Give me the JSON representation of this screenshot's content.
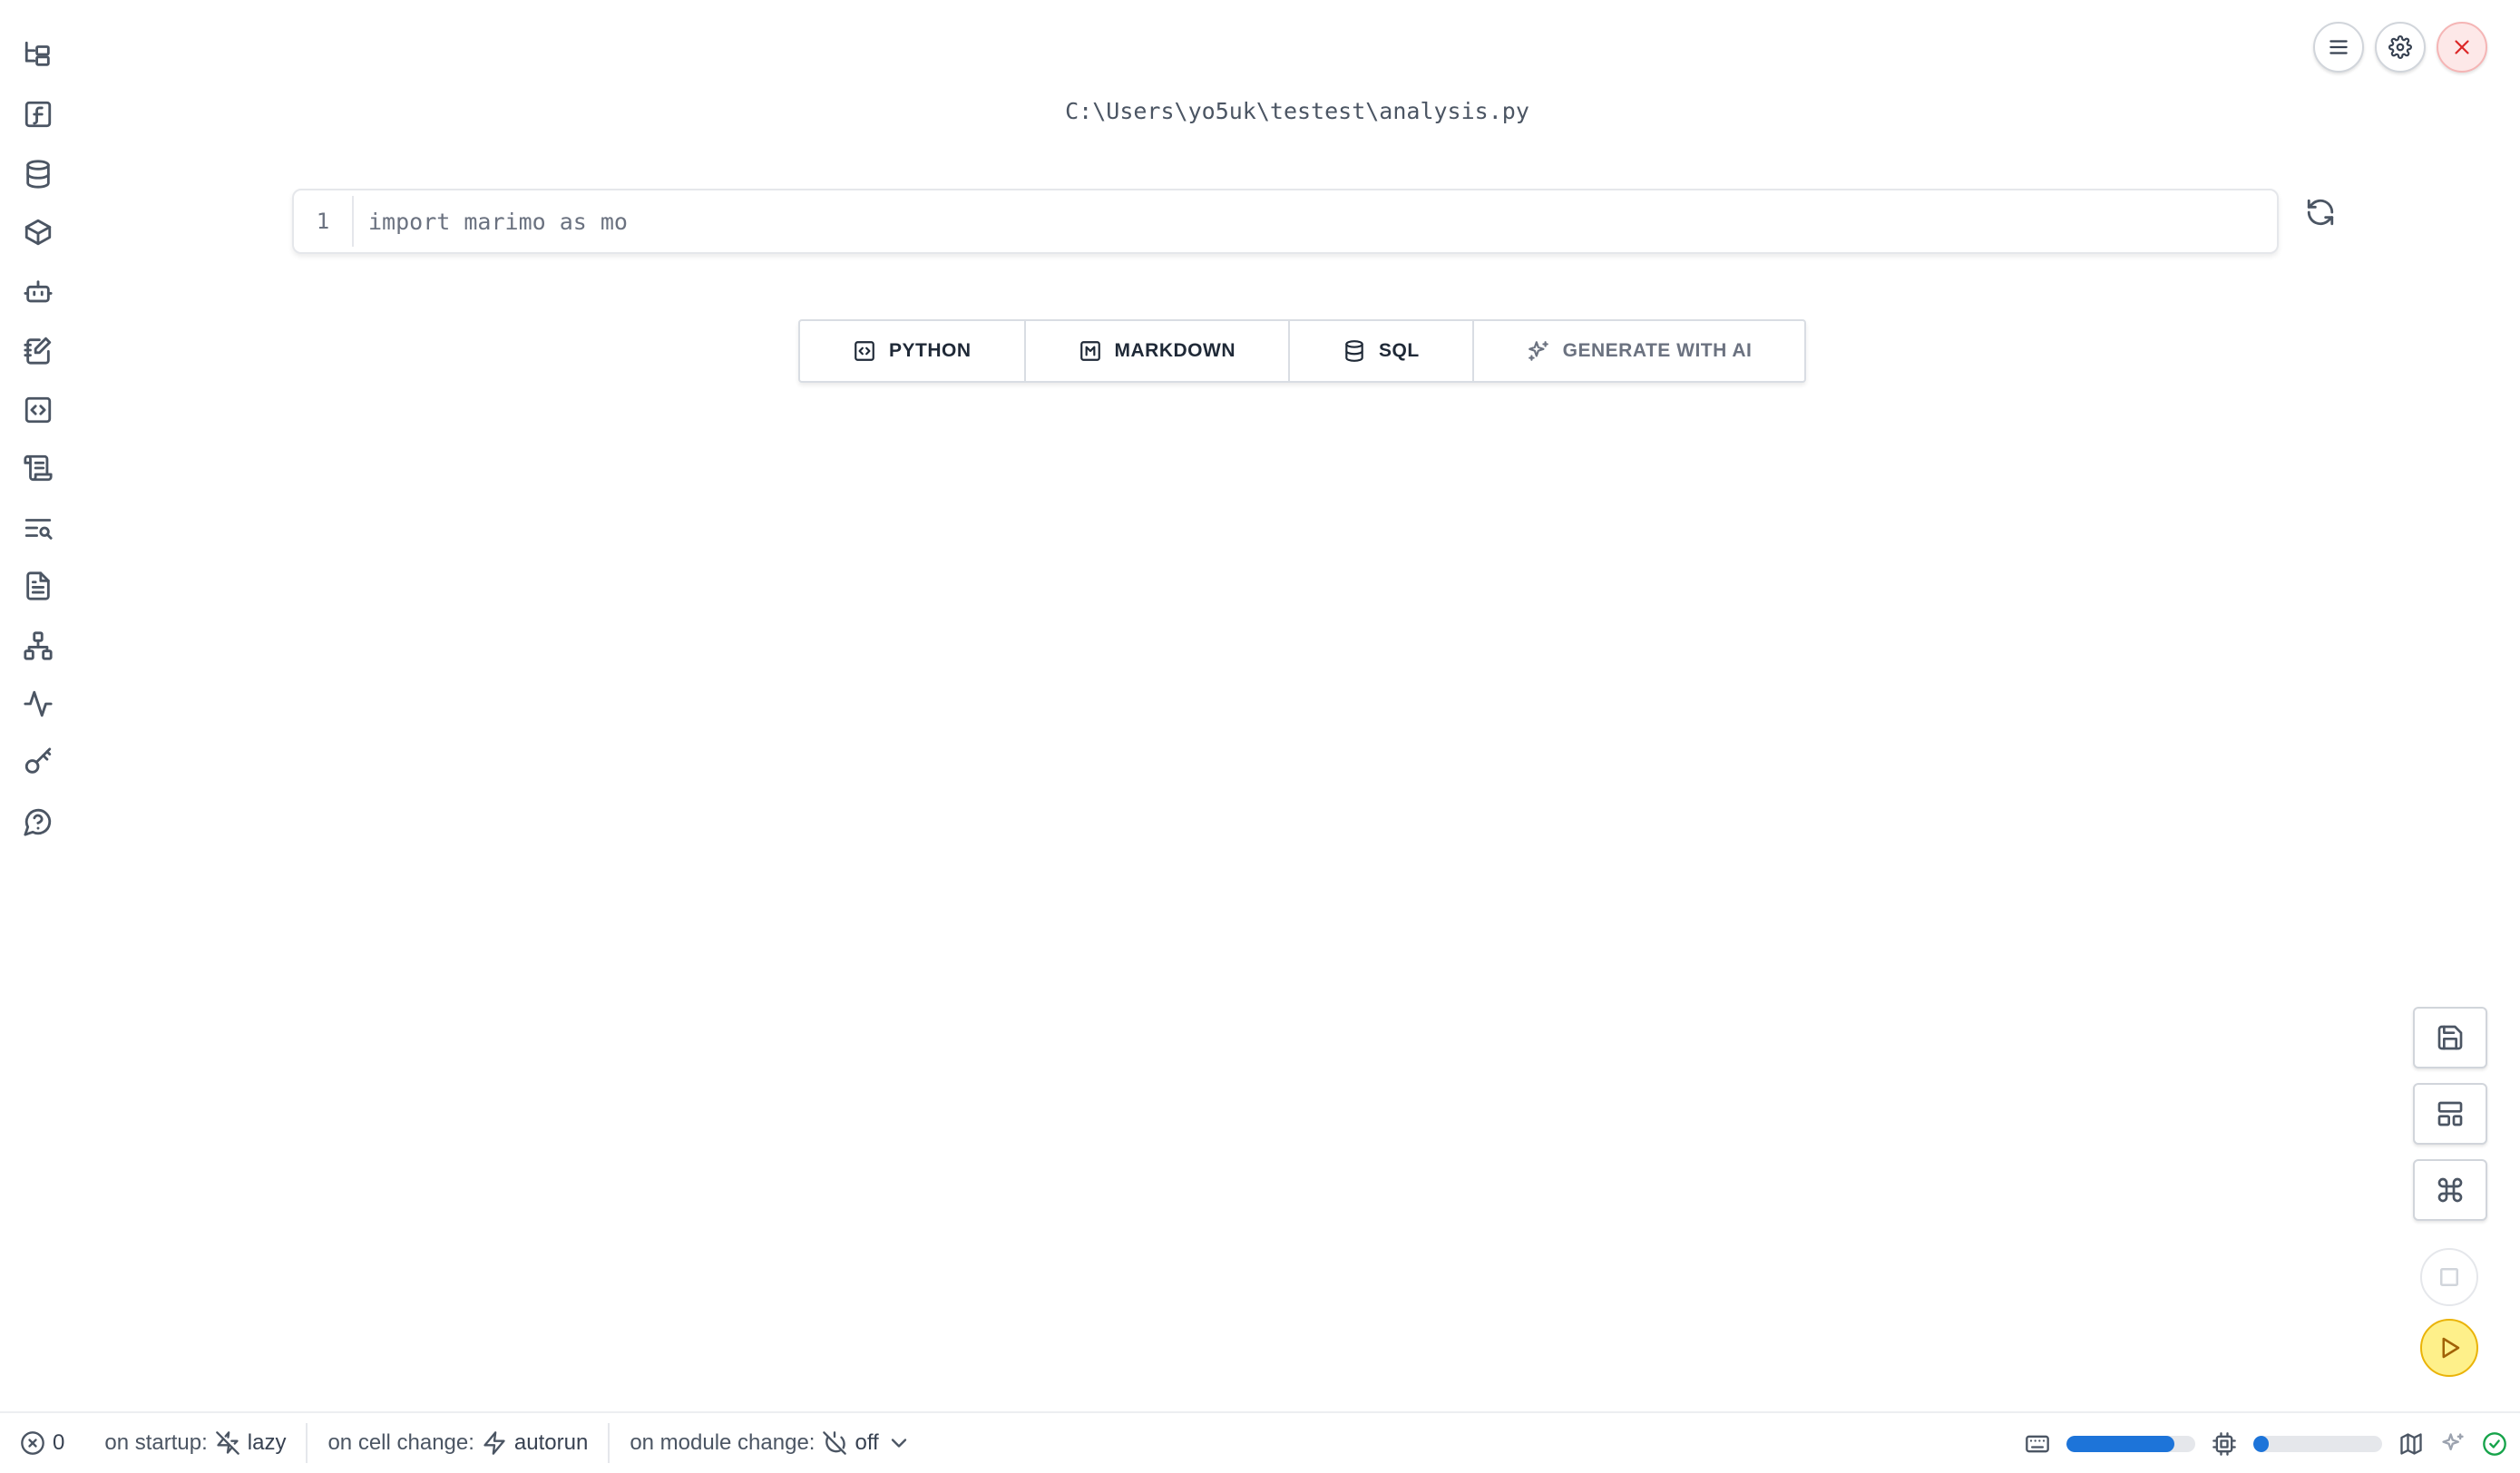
{
  "notebook": {
    "filename": "C:\\Users\\yo5uk\\testest\\analysis.py",
    "cell": {
      "line_number": "1",
      "code": "import marimo as mo"
    }
  },
  "add_cell": {
    "python_label": "PYTHON",
    "markdown_label": "MARKDOWN",
    "sql_label": "SQL",
    "ai_label": "GENERATE WITH AI"
  },
  "sidebar": {
    "icons": [
      "file-explorer-icon",
      "variables-icon",
      "datasources-icon",
      "packages-icon",
      "ai-assistant-icon",
      "scratchpad-icon",
      "snippets-icon",
      "logs-icon",
      "outline-icon",
      "documentation-icon",
      "dependencies-icon",
      "tracing-icon",
      "secrets-icon",
      "help-icon"
    ]
  },
  "footer": {
    "error_count": "0",
    "startup_label": "on startup:",
    "startup_value": "lazy",
    "cell_change_label": "on cell change:",
    "cell_change_value": "autorun",
    "module_change_label": "on module change:",
    "module_change_value": "off",
    "memory_usage": 0.84,
    "cpu_usage": 0.12,
    "status_color": "#16a34a",
    "meter_color": "#1d74d9"
  },
  "run_button_color": "#fef08a"
}
